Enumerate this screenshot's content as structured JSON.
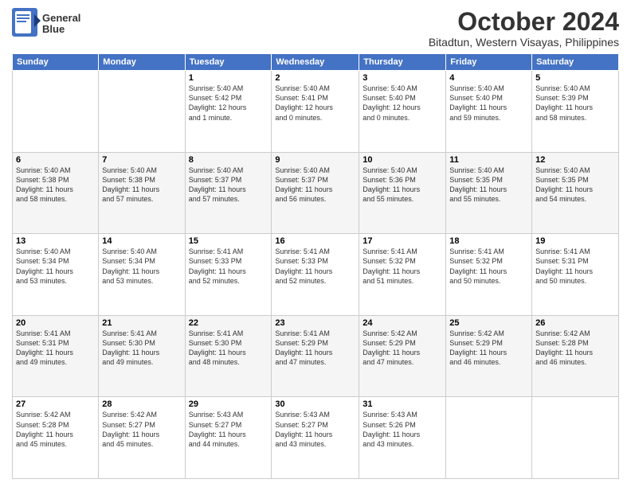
{
  "header": {
    "logo_line1": "General",
    "logo_line2": "Blue",
    "month": "October 2024",
    "location": "Bitadtun, Western Visayas, Philippines"
  },
  "days_of_week": [
    "Sunday",
    "Monday",
    "Tuesday",
    "Wednesday",
    "Thursday",
    "Friday",
    "Saturday"
  ],
  "weeks": [
    [
      {
        "day": "",
        "detail": ""
      },
      {
        "day": "",
        "detail": ""
      },
      {
        "day": "1",
        "detail": "Sunrise: 5:40 AM\nSunset: 5:42 PM\nDaylight: 12 hours\nand 1 minute."
      },
      {
        "day": "2",
        "detail": "Sunrise: 5:40 AM\nSunset: 5:41 PM\nDaylight: 12 hours\nand 0 minutes."
      },
      {
        "day": "3",
        "detail": "Sunrise: 5:40 AM\nSunset: 5:40 PM\nDaylight: 12 hours\nand 0 minutes."
      },
      {
        "day": "4",
        "detail": "Sunrise: 5:40 AM\nSunset: 5:40 PM\nDaylight: 11 hours\nand 59 minutes."
      },
      {
        "day": "5",
        "detail": "Sunrise: 5:40 AM\nSunset: 5:39 PM\nDaylight: 11 hours\nand 58 minutes."
      }
    ],
    [
      {
        "day": "6",
        "detail": "Sunrise: 5:40 AM\nSunset: 5:38 PM\nDaylight: 11 hours\nand 58 minutes."
      },
      {
        "day": "7",
        "detail": "Sunrise: 5:40 AM\nSunset: 5:38 PM\nDaylight: 11 hours\nand 57 minutes."
      },
      {
        "day": "8",
        "detail": "Sunrise: 5:40 AM\nSunset: 5:37 PM\nDaylight: 11 hours\nand 57 minutes."
      },
      {
        "day": "9",
        "detail": "Sunrise: 5:40 AM\nSunset: 5:37 PM\nDaylight: 11 hours\nand 56 minutes."
      },
      {
        "day": "10",
        "detail": "Sunrise: 5:40 AM\nSunset: 5:36 PM\nDaylight: 11 hours\nand 55 minutes."
      },
      {
        "day": "11",
        "detail": "Sunrise: 5:40 AM\nSunset: 5:35 PM\nDaylight: 11 hours\nand 55 minutes."
      },
      {
        "day": "12",
        "detail": "Sunrise: 5:40 AM\nSunset: 5:35 PM\nDaylight: 11 hours\nand 54 minutes."
      }
    ],
    [
      {
        "day": "13",
        "detail": "Sunrise: 5:40 AM\nSunset: 5:34 PM\nDaylight: 11 hours\nand 53 minutes."
      },
      {
        "day": "14",
        "detail": "Sunrise: 5:40 AM\nSunset: 5:34 PM\nDaylight: 11 hours\nand 53 minutes."
      },
      {
        "day": "15",
        "detail": "Sunrise: 5:41 AM\nSunset: 5:33 PM\nDaylight: 11 hours\nand 52 minutes."
      },
      {
        "day": "16",
        "detail": "Sunrise: 5:41 AM\nSunset: 5:33 PM\nDaylight: 11 hours\nand 52 minutes."
      },
      {
        "day": "17",
        "detail": "Sunrise: 5:41 AM\nSunset: 5:32 PM\nDaylight: 11 hours\nand 51 minutes."
      },
      {
        "day": "18",
        "detail": "Sunrise: 5:41 AM\nSunset: 5:32 PM\nDaylight: 11 hours\nand 50 minutes."
      },
      {
        "day": "19",
        "detail": "Sunrise: 5:41 AM\nSunset: 5:31 PM\nDaylight: 11 hours\nand 50 minutes."
      }
    ],
    [
      {
        "day": "20",
        "detail": "Sunrise: 5:41 AM\nSunset: 5:31 PM\nDaylight: 11 hours\nand 49 minutes."
      },
      {
        "day": "21",
        "detail": "Sunrise: 5:41 AM\nSunset: 5:30 PM\nDaylight: 11 hours\nand 49 minutes."
      },
      {
        "day": "22",
        "detail": "Sunrise: 5:41 AM\nSunset: 5:30 PM\nDaylight: 11 hours\nand 48 minutes."
      },
      {
        "day": "23",
        "detail": "Sunrise: 5:41 AM\nSunset: 5:29 PM\nDaylight: 11 hours\nand 47 minutes."
      },
      {
        "day": "24",
        "detail": "Sunrise: 5:42 AM\nSunset: 5:29 PM\nDaylight: 11 hours\nand 47 minutes."
      },
      {
        "day": "25",
        "detail": "Sunrise: 5:42 AM\nSunset: 5:29 PM\nDaylight: 11 hours\nand 46 minutes."
      },
      {
        "day": "26",
        "detail": "Sunrise: 5:42 AM\nSunset: 5:28 PM\nDaylight: 11 hours\nand 46 minutes."
      }
    ],
    [
      {
        "day": "27",
        "detail": "Sunrise: 5:42 AM\nSunset: 5:28 PM\nDaylight: 11 hours\nand 45 minutes."
      },
      {
        "day": "28",
        "detail": "Sunrise: 5:42 AM\nSunset: 5:27 PM\nDaylight: 11 hours\nand 45 minutes."
      },
      {
        "day": "29",
        "detail": "Sunrise: 5:43 AM\nSunset: 5:27 PM\nDaylight: 11 hours\nand 44 minutes."
      },
      {
        "day": "30",
        "detail": "Sunrise: 5:43 AM\nSunset: 5:27 PM\nDaylight: 11 hours\nand 43 minutes."
      },
      {
        "day": "31",
        "detail": "Sunrise: 5:43 AM\nSunset: 5:26 PM\nDaylight: 11 hours\nand 43 minutes."
      },
      {
        "day": "",
        "detail": ""
      },
      {
        "day": "",
        "detail": ""
      }
    ]
  ]
}
